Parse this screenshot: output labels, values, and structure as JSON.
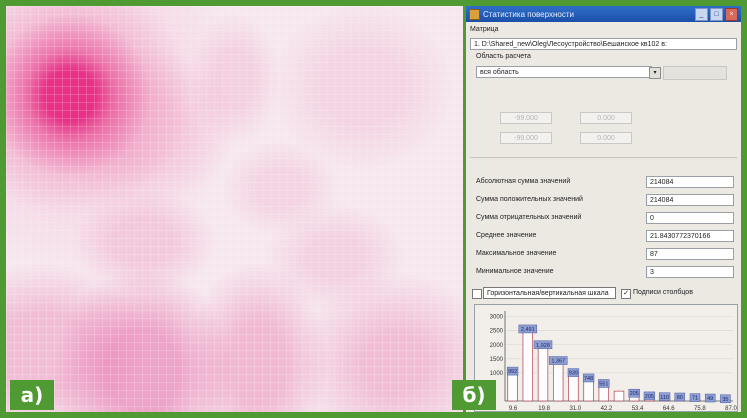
{
  "labels": {
    "left": "а)",
    "right": "б)"
  },
  "window": {
    "title": "Статистика поверхности"
  },
  "matrix": {
    "label": "Матрица",
    "value": "1. D:\\Shared_new\\Oleg\\Лесоустройство\\Бешанское кв102 в:"
  },
  "area": {
    "label": "Область расчета",
    "value": "вся область",
    "coords": [
      "-99.000",
      "0.000",
      "-99.000",
      "0.000"
    ]
  },
  "stats": [
    {
      "label": "Абсолютная сумма значений",
      "value": "214084"
    },
    {
      "label": "Сумма положительных значений",
      "value": "214084"
    },
    {
      "label": "Сумма отрицательных значений",
      "value": "0"
    },
    {
      "label": "Среднее значение",
      "value": "21.8430772370166"
    },
    {
      "label": "Максимальное значение",
      "value": "87"
    },
    {
      "label": "Минимальное значение",
      "value": "3"
    }
  ],
  "options": {
    "scale_label": "Горизонтальная/вертикальная шкала",
    "scale_checked": false,
    "captions_label": "Подписи столбцов",
    "captions_checked": true,
    "dropdown_arrow": "▾"
  },
  "chart_data": {
    "type": "bar",
    "bar_color": "#8e9ed2",
    "x_ticks": [
      "9.6",
      "19.8",
      "31.0",
      "42.2",
      "53.4",
      "64.6",
      "75.8",
      "87.0"
    ],
    "y_ticks": [
      "3000",
      "2500",
      "2000",
      "1500",
      "1000"
    ],
    "ylim": [
      0,
      3200
    ],
    "values": [
      992,
      2491,
      1928,
      1367,
      939,
      748,
      551,
      351,
      206,
      110,
      80,
      71,
      49,
      35,
      8
    ],
    "value_labels": [
      "992",
      "2,491",
      "1,928",
      "1,367",
      "939",
      "748",
      "551",
      "",
      "205",
      "205",
      "110",
      "80",
      "71",
      "49",
      "35",
      "8"
    ]
  }
}
